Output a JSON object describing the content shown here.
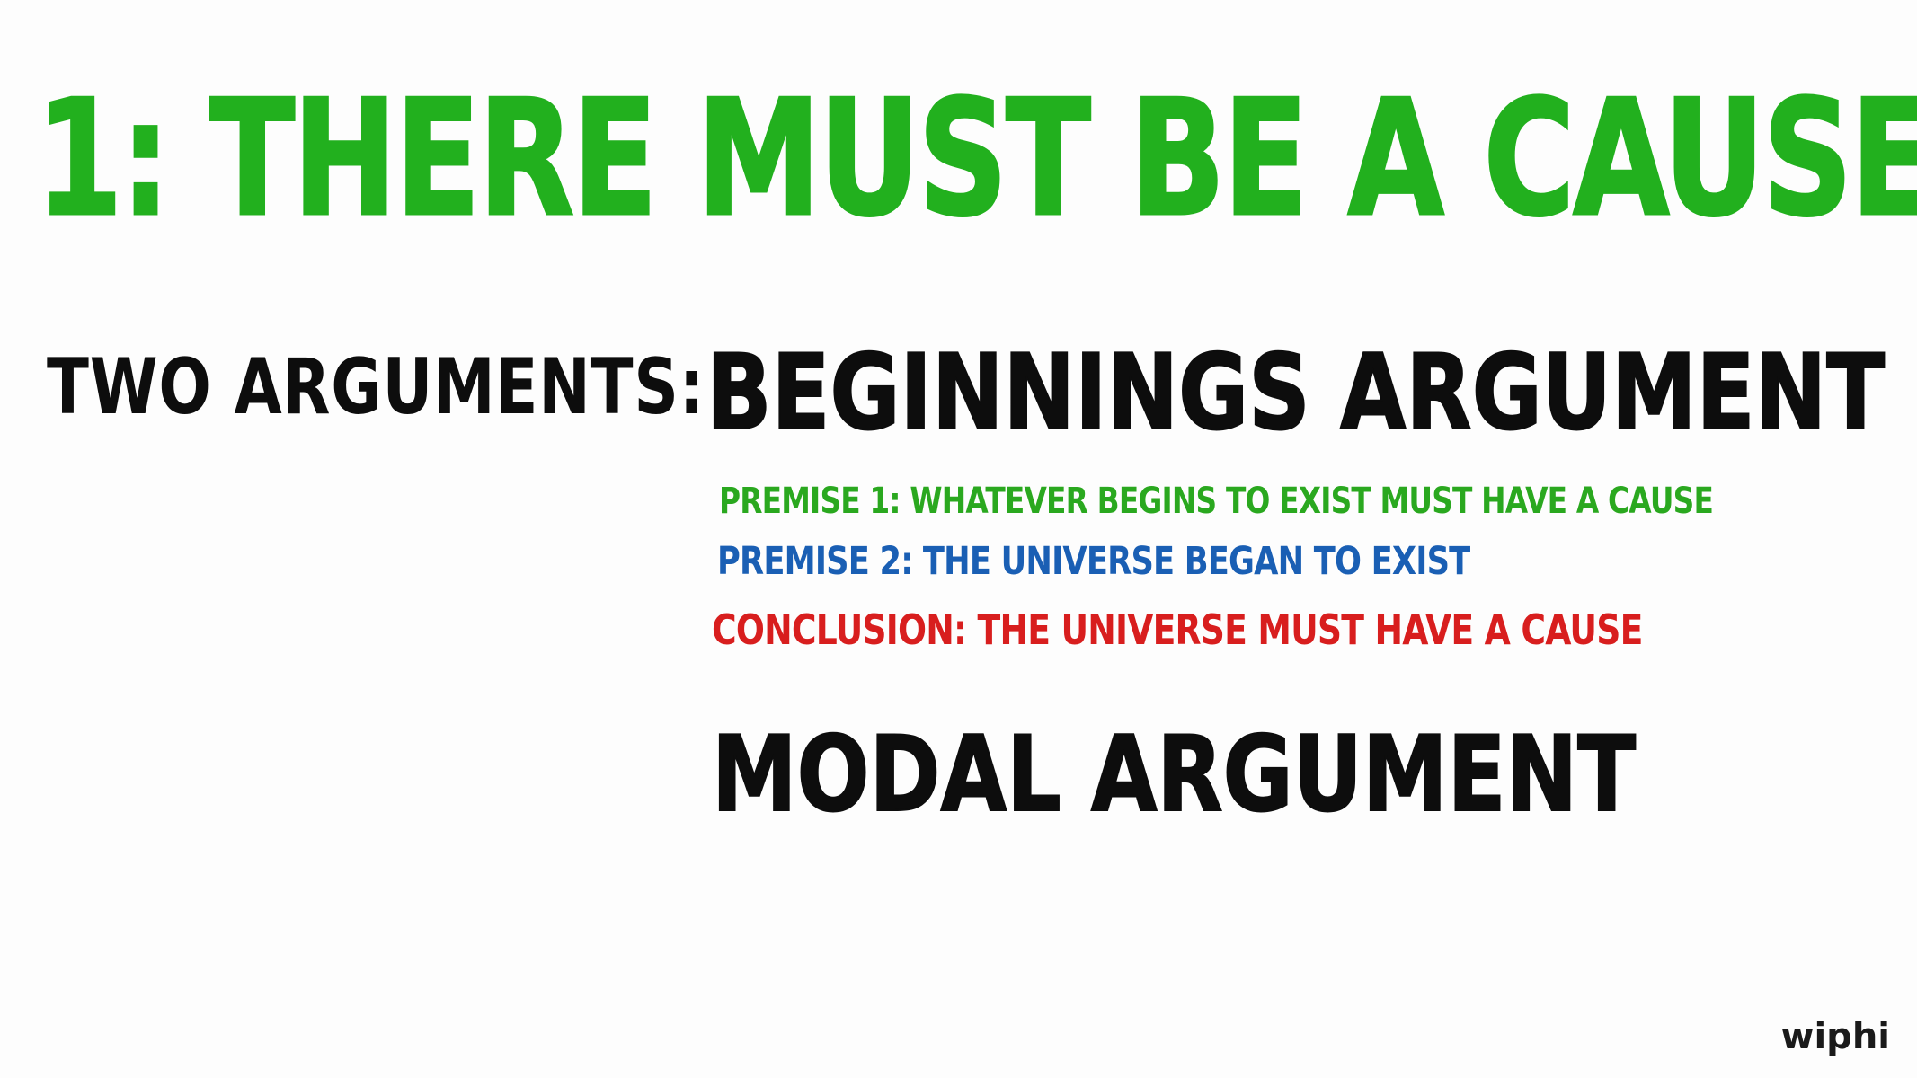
{
  "slide": {
    "title": "1: THERE MUST BE A CAUSE.",
    "two_arguments_label": "TWO ARGUMENTS:",
    "beginnings_argument": {
      "heading": "BEGINNINGS ARGUMENT",
      "premise_1": "PREMISE 1: WHATEVER BEGINS TO EXIST MUST HAVE A CAUSE",
      "premise_2": "PREMISE 2: THE UNIVERSE BEGAN TO EXIST",
      "conclusion": "CONCLUSION: THE UNIVERSE MUST HAVE A CAUSE"
    },
    "modal_argument": {
      "heading": "MODAL ARGUMENT"
    }
  },
  "logo": {
    "text": "wiphi"
  },
  "colors": {
    "background": "#fdfdfd",
    "title_green": "#22b01e",
    "premise_green": "#2aa81f",
    "premise_blue": "#1a5fb4",
    "conclusion_red": "#d81e1e",
    "heading_black": "#0d0d0d",
    "logo_dot_blue": "#3b9fe0"
  }
}
